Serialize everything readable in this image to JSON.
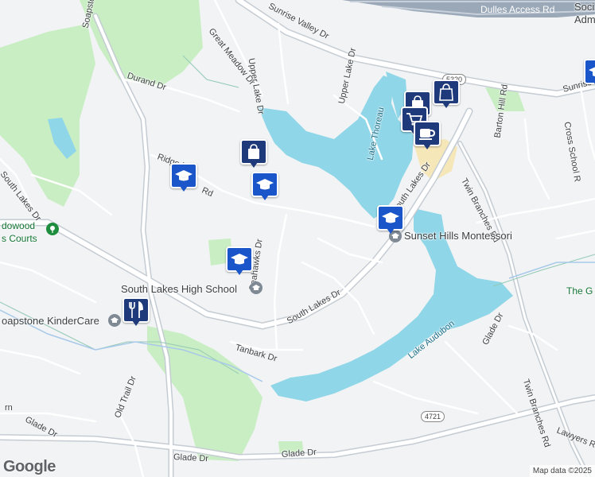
{
  "map": {
    "roads": {
      "dulles_access": "Dulles Access Rd",
      "sunrise_valley_top": "Sunrise Valley Dr",
      "sunrise_valley_right": "Sunrise Valley Dr",
      "soapstone": "Soapstone",
      "great_meadow": "Great Meadow Dr",
      "upper_lake_dr_left": "Upper Lake Dr",
      "upper_lake_dr_right": "Upper Lake Dr",
      "durand": "Durand Dr",
      "ridge_heights": "Ridge H",
      "ridge_heights_rd": "Rd",
      "south_lakes_dr_left": "South Lakes Dr",
      "south_lakes_dr_mid": "South Lakes Dr",
      "south_lakes_dr_right": "South Lakes Dr",
      "twin_branches_top": "Twin Branches Rd",
      "twin_branches_bottom": "Twin Branches Rd",
      "cross_school": "Cross School R",
      "barton_hill": "Barton Hill Rd",
      "seahawks": "Seahawks Dr",
      "tanbark": "Tanbark Dr",
      "glade_dr_left": "Glade Dr",
      "glade_dr_mid1": "Glade Dr",
      "glade_dr_mid2": "Glade Dr",
      "glade_dr_right": "Glade Dr",
      "old_trail": "Old Trail Dr",
      "lawyers": "Lawyers R",
      "rn": "rn"
    },
    "water": {
      "lake_thoreau": "Lake Thoreau",
      "lake_audubon": "Lake Audubon"
    },
    "places": {
      "south_lakes_hs": "South Lakes High School",
      "sunset_hills_montessori": "Sunset Hills Montessori",
      "soapstone_kindercare": "oapstone KinderCare",
      "hidden_wood_courts_1": "dowood",
      "hidden_wood_courts_2": "s Courts",
      "social_admin_1": "Soci",
      "social_admin_2": "Admi",
      "the_g": "The G"
    },
    "shields": {
      "r5320": "5320",
      "r4721": "4721"
    },
    "icons": [
      "school-icon",
      "shopping-bag-icon",
      "restaurant-icon",
      "cafe-icon",
      "grocery-cart-icon",
      "park-icon"
    ],
    "colors": {
      "water": "#8ed6e8",
      "park": "#c9eec3",
      "road": "#ffffff",
      "highway": "#b9c2cc",
      "pin": "#1a56c9"
    }
  },
  "footer": {
    "logo": "Google",
    "attribution": "Map data ©2025"
  }
}
